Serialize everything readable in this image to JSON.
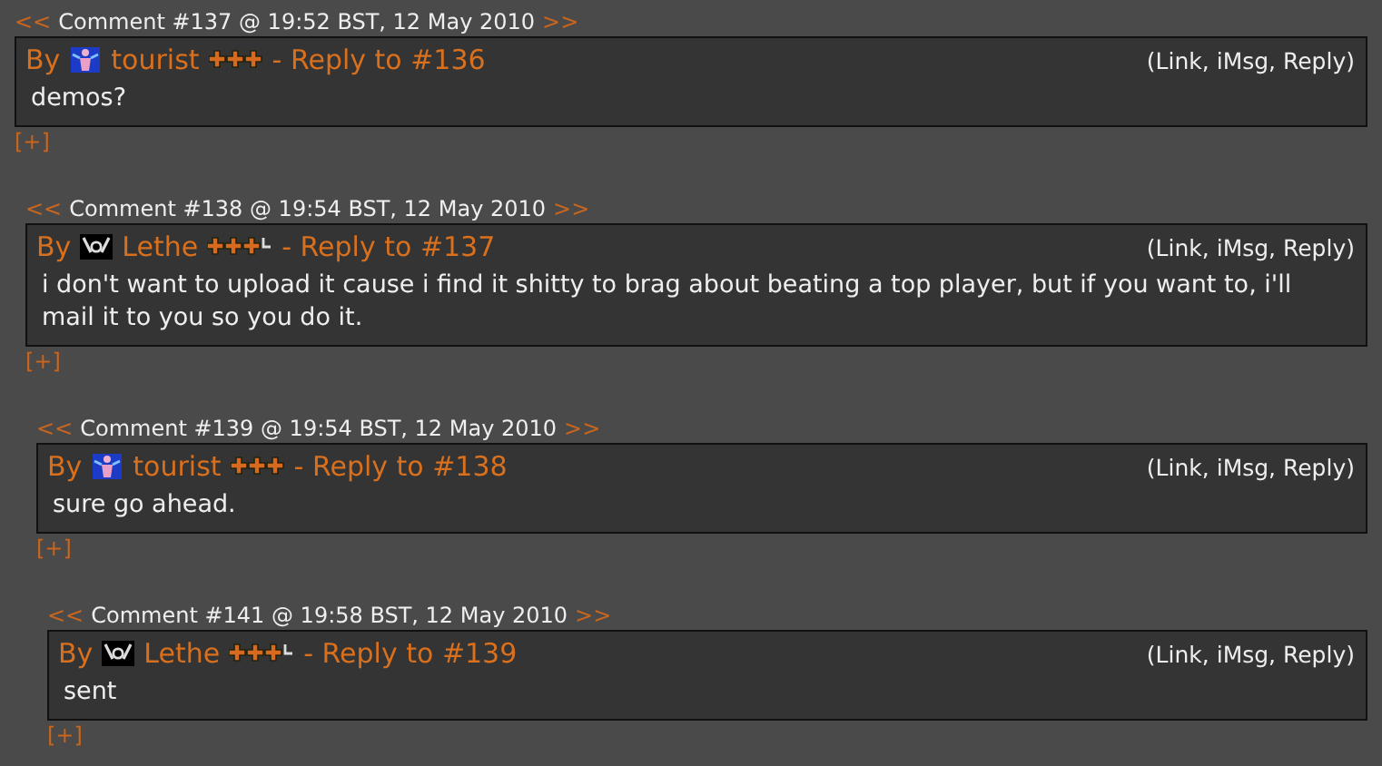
{
  "comments": [
    {
      "prev": "<<",
      "header": "Comment #137 @ 19:52 BST, 12 May 2010",
      "next": ">>",
      "by": "By",
      "avatar": {
        "kind": "figure"
      },
      "author": "tourist",
      "rank_extra": false,
      "reply": "- Reply to #136",
      "actions": "(Link, iMsg, Reply)",
      "body": "demos?",
      "expand": "[+]",
      "children": [
        {
          "prev": "<<",
          "header": "Comment #138 @ 19:54 BST, 12 May 2010",
          "next": ">>",
          "by": "By",
          "avatar": {
            "kind": "cheer"
          },
          "author": "Lethe",
          "rank_extra": true,
          "reply": "- Reply to #137",
          "actions": "(Link, iMsg, Reply)",
          "body": "i don't want to upload it cause i find it shitty to brag about beating a top player, but if you want to, i'll mail it to you so you do it.",
          "expand": "[+]",
          "children": [
            {
              "prev": "<<",
              "header": "Comment #139 @ 19:54 BST, 12 May 2010",
              "next": ">>",
              "by": "By",
              "avatar": {
                "kind": "figure"
              },
              "author": "tourist",
              "rank_extra": false,
              "reply": "- Reply to #138",
              "actions": "(Link, iMsg, Reply)",
              "body": "sure go ahead.",
              "expand": "[+]",
              "children": [
                {
                  "prev": "<<",
                  "header": "Comment #141 @ 19:58 BST, 12 May 2010",
                  "next": ">>",
                  "by": "By",
                  "avatar": {
                    "kind": "cheer"
                  },
                  "author": "Lethe",
                  "rank_extra": true,
                  "reply": "- Reply to #139",
                  "actions": "(Link, iMsg, Reply)",
                  "body": "sent",
                  "expand": "[+]"
                }
              ]
            }
          ]
        }
      ]
    }
  ]
}
